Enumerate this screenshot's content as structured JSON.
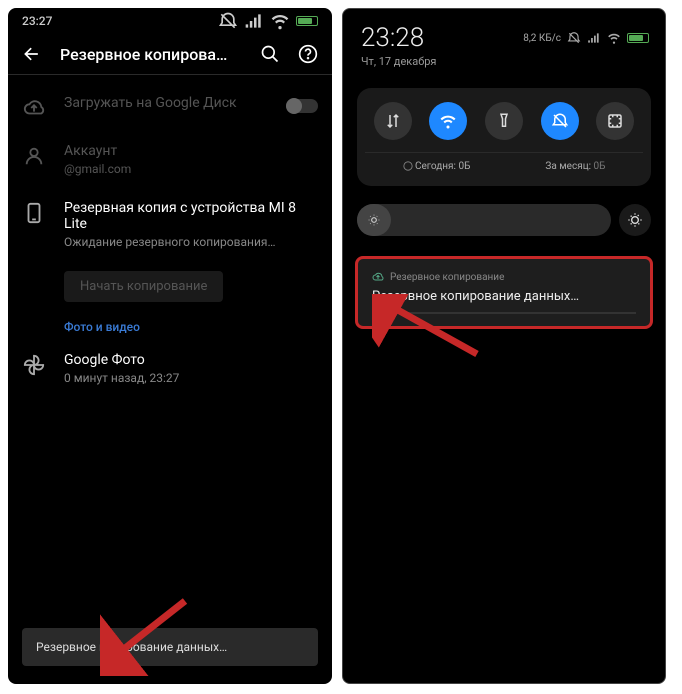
{
  "left": {
    "time": "23:27",
    "title": "Резервное копирова…",
    "upload": {
      "title": "Загружать на Google Диск"
    },
    "account": {
      "label": "Аккаунт",
      "email": "@gmail.com"
    },
    "device": {
      "title": "Резервная копия с устройства MI 8 Lite",
      "sub": "Ожидание резервного копирования…"
    },
    "start_btn": "Начать копирование",
    "section_media": "Фото и видео",
    "gphoto": {
      "title": "Google Фото",
      "sub": "0 минут назад, 23:27"
    },
    "toast": "Резервное копирование данных…"
  },
  "right": {
    "time": "23:28",
    "date": "Чт, 17 декабря",
    "speed": "8,2 КБ/с",
    "data": {
      "today_label": "Сегодня:",
      "today_val": "0Б",
      "month_label": "За месяц:",
      "month_val": "0Б"
    },
    "notif": {
      "app": "Резервное копирование",
      "title": "Резервное копирование данных…"
    }
  }
}
